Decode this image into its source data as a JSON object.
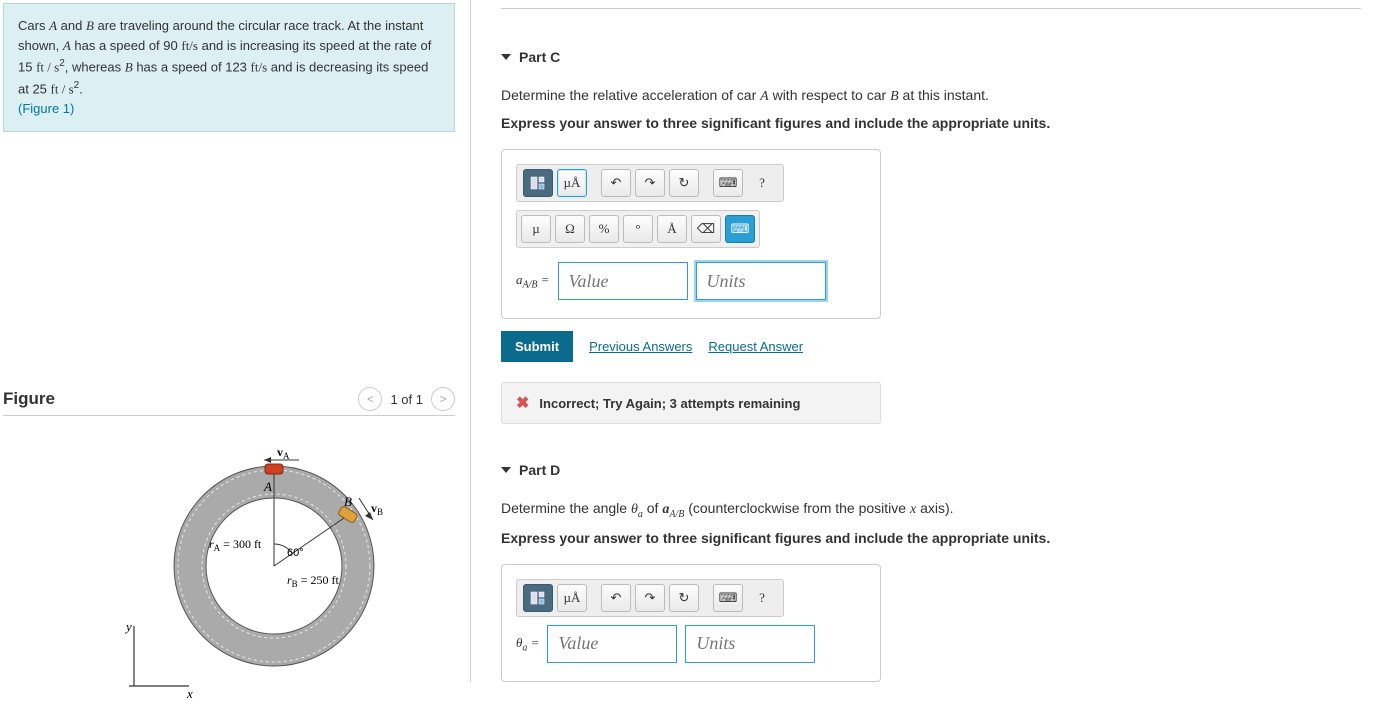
{
  "problem": {
    "text_prefix": "Cars ",
    "car_a": "A",
    "text_mid1": " and ",
    "car_b": "B",
    "text_mid2": " are traveling around the circular race track. At the instant shown, ",
    "text_mid3": " has a speed of 90 ",
    "speed_unit": "ft/s",
    "text_mid4": " and is increasing its speed at the rate of 15 ",
    "accel_unit": "ft / s",
    "text_mid5": ", whereas ",
    "text_mid6": " has a speed of 123 ",
    "text_mid7": " and is decreasing its speed at 25 ",
    "text_mid8": ".",
    "figure_link": "(Figure 1)"
  },
  "figure": {
    "heading": "Figure",
    "pager": "1 of 1",
    "labels": {
      "va": "v",
      "va_sub": "A",
      "A": "A",
      "B": "B",
      "vb": "v",
      "vb_sub": "B",
      "ra": "r",
      "ra_sub": "A",
      "ra_val": " = 300 ft",
      "rb": "r",
      "rb_sub": "B",
      "rb_val": " = 250 ft",
      "angle": "60°",
      "x": "x",
      "y": "y"
    }
  },
  "partC": {
    "title": "Part C",
    "prompt_a": "Determine the relative acceleration of car ",
    "prompt_b": " with respect to car ",
    "prompt_c": " at this instant.",
    "instruct": "Express your answer to three significant figures and include the appropriate units.",
    "label_html": "a",
    "label_sub": "A/B",
    "label_eq": " = ",
    "value_ph": "Value",
    "units_ph": "Units",
    "submit": "Submit",
    "prev": "Previous Answers",
    "req": "Request Answer",
    "feedback": "Incorrect; Try Again; 3 attempts remaining"
  },
  "partD": {
    "title": "Part D",
    "prompt_a": "Determine the angle ",
    "theta": "θ",
    "theta_sub": "a",
    "prompt_b": " of ",
    "a": "a",
    "a_sub": "A/B",
    "prompt_c": " (counterclockwise from the positive ",
    "x": "x",
    "prompt_d": " axis).",
    "instruct": "Express your answer to three significant figures and include the appropriate units.",
    "label": "θ",
    "label_sub": "a",
    "label_eq": " = ",
    "value_ph": "Value",
    "units_ph": "Units"
  },
  "toolbar": {
    "templates": "▦",
    "special": "µÅ",
    "undo": "↶",
    "redo": "↷",
    "reset": "↻",
    "keyboard": "⌨",
    "help": "?"
  },
  "palette": {
    "mu": "µ",
    "omega": "Ω",
    "percent": "%",
    "degree": "°",
    "angstrom": "Å",
    "backspace": "⌫",
    "kbd": "⌨"
  }
}
